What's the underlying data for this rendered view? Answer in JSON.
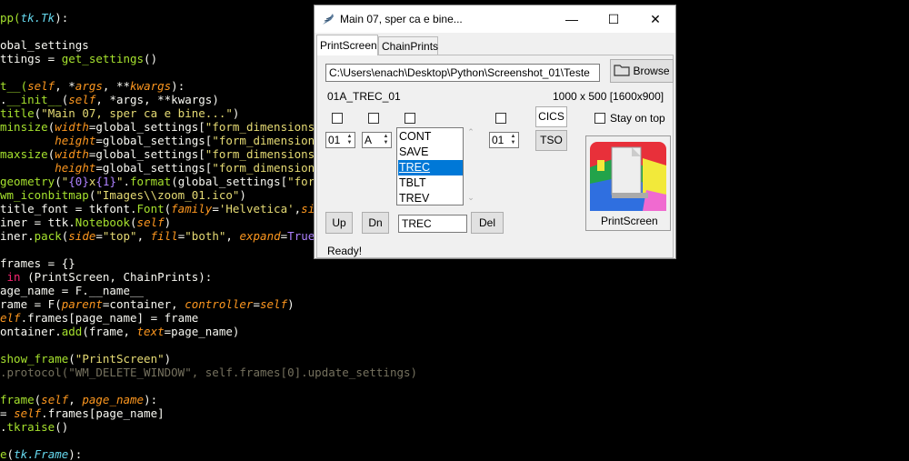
{
  "editor": {
    "lines": [
      {
        "segs": [
          [
            "c-g",
            "pp("
          ],
          [
            "c-b",
            "tk.Tk"
          ],
          [
            "c-w",
            "):"
          ]
        ]
      },
      {
        "segs": []
      },
      {
        "segs": [
          [
            "c-w",
            "obal_settings"
          ]
        ]
      },
      {
        "segs": [
          [
            "c-w",
            "ttings = "
          ],
          [
            "c-g",
            "get_settings"
          ],
          [
            "c-w",
            "()"
          ]
        ]
      },
      {
        "segs": []
      },
      {
        "segs": [
          [
            "c-g",
            "t__("
          ],
          [
            "c-o",
            "self"
          ],
          [
            "c-w",
            ", *"
          ],
          [
            "c-o",
            "args"
          ],
          [
            "c-w",
            ", **"
          ],
          [
            "c-o",
            "kwargs"
          ],
          [
            "c-w",
            "):"
          ]
        ]
      },
      {
        "segs": [
          [
            "c-w",
            "."
          ],
          [
            "c-g",
            "__init__"
          ],
          [
            "c-w",
            "("
          ],
          [
            "c-o",
            "self"
          ],
          [
            "c-w",
            ", *args, **kwargs)"
          ]
        ]
      },
      {
        "segs": [
          [
            "c-g",
            "title"
          ],
          [
            "c-w",
            "("
          ],
          [
            "c-s",
            "\"Main 07, sper ca e bine...\""
          ],
          [
            "c-w",
            ")"
          ]
        ]
      },
      {
        "segs": [
          [
            "c-g",
            "minsize"
          ],
          [
            "c-w",
            "("
          ],
          [
            "c-o",
            "width"
          ],
          [
            "c-w",
            "=global_settings["
          ],
          [
            "c-s",
            "\"form_dimensions\""
          ],
          [
            "c-w",
            "]["
          ]
        ]
      },
      {
        "segs": [
          [
            "c-w",
            "        "
          ],
          [
            "c-o",
            "height"
          ],
          [
            "c-w",
            "=global_settings["
          ],
          [
            "c-s",
            "\"form_dimensions\""
          ],
          [
            "c-w",
            "]["
          ]
        ]
      },
      {
        "segs": [
          [
            "c-g",
            "maxsize"
          ],
          [
            "c-w",
            "("
          ],
          [
            "c-o",
            "width"
          ],
          [
            "c-w",
            "=global_settings["
          ],
          [
            "c-s",
            "\"form_dimensions\""
          ],
          [
            "c-w",
            "]["
          ]
        ]
      },
      {
        "segs": [
          [
            "c-w",
            "        "
          ],
          [
            "c-o",
            "height"
          ],
          [
            "c-w",
            "=global_settings["
          ],
          [
            "c-s",
            "\"form_dimensions\""
          ],
          [
            "c-w",
            "]["
          ]
        ]
      },
      {
        "segs": [
          [
            "c-g",
            "geometry"
          ],
          [
            "c-w",
            "("
          ],
          [
            "c-s",
            "\""
          ],
          [
            "c-p",
            "{0}"
          ],
          [
            "c-s",
            "x"
          ],
          [
            "c-p",
            "{1}"
          ],
          [
            "c-s",
            "\""
          ],
          [
            "c-w",
            "."
          ],
          [
            "c-g",
            "format"
          ],
          [
            "c-w",
            "(global_settings["
          ],
          [
            "c-s",
            "\"form_d"
          ]
        ]
      },
      {
        "segs": [
          [
            "c-g",
            "wm_iconbitmap"
          ],
          [
            "c-w",
            "("
          ],
          [
            "c-s",
            "\"Images\\\\zoom_01.ico\""
          ],
          [
            "c-w",
            ")"
          ]
        ]
      },
      {
        "segs": [
          [
            "c-w",
            "title_font = tkfont."
          ],
          [
            "c-g",
            "Font"
          ],
          [
            "c-w",
            "("
          ],
          [
            "c-o",
            "family"
          ],
          [
            "c-w",
            "="
          ],
          [
            "c-s",
            "'Helvetica'"
          ],
          [
            "c-w",
            ","
          ],
          [
            "c-o",
            "size"
          ],
          [
            "c-w",
            "="
          ]
        ]
      },
      {
        "segs": [
          [
            "c-w",
            "iner = ttk."
          ],
          [
            "c-g",
            "Notebook"
          ],
          [
            "c-w",
            "("
          ],
          [
            "c-o",
            "self"
          ],
          [
            "c-w",
            ")"
          ]
        ]
      },
      {
        "segs": [
          [
            "c-w",
            "iner."
          ],
          [
            "c-g",
            "pack"
          ],
          [
            "c-w",
            "("
          ],
          [
            "c-o",
            "side"
          ],
          [
            "c-w",
            "="
          ],
          [
            "c-s",
            "\"top\""
          ],
          [
            "c-w",
            ", "
          ],
          [
            "c-o",
            "fill"
          ],
          [
            "c-w",
            "="
          ],
          [
            "c-s",
            "\"both\""
          ],
          [
            "c-w",
            ", "
          ],
          [
            "c-o",
            "expand"
          ],
          [
            "c-w",
            "="
          ],
          [
            "c-p",
            "True"
          ],
          [
            "c-w",
            ")"
          ]
        ]
      },
      {
        "segs": []
      },
      {
        "segs": [
          [
            "c-w",
            "frames = {}"
          ]
        ]
      },
      {
        "segs": [
          [
            "c-k",
            " in "
          ],
          [
            "c-w",
            "(PrintScreen, ChainPrints):"
          ]
        ]
      },
      {
        "segs": [
          [
            "c-w",
            "age_name = F.__name__"
          ]
        ]
      },
      {
        "segs": [
          [
            "c-w",
            "rame = F("
          ],
          [
            "c-o",
            "parent"
          ],
          [
            "c-w",
            "=container, "
          ],
          [
            "c-o",
            "controller"
          ],
          [
            "c-w",
            "="
          ],
          [
            "c-o",
            "self"
          ],
          [
            "c-w",
            ")"
          ]
        ]
      },
      {
        "segs": [
          [
            "c-o",
            "elf"
          ],
          [
            "c-w",
            ".frames[page_name] = frame"
          ]
        ]
      },
      {
        "segs": [
          [
            "c-w",
            "ontainer."
          ],
          [
            "c-g",
            "add"
          ],
          [
            "c-w",
            "(frame, "
          ],
          [
            "c-o",
            "text"
          ],
          [
            "c-w",
            "=page_name)"
          ]
        ]
      },
      {
        "segs": []
      },
      {
        "segs": [
          [
            "c-g",
            "show_frame"
          ],
          [
            "c-w",
            "("
          ],
          [
            "c-s",
            "\"PrintScreen\""
          ],
          [
            "c-w",
            ")"
          ]
        ]
      },
      {
        "segs": [
          [
            "c-dim",
            ".protocol(\"WM_DELETE_WINDOW\", self.frames[0].update_settings)"
          ]
        ]
      },
      {
        "segs": []
      },
      {
        "segs": [
          [
            "c-g",
            "frame"
          ],
          [
            "c-w",
            "("
          ],
          [
            "c-o",
            "self"
          ],
          [
            "c-w",
            ", "
          ],
          [
            "c-o",
            "page_name"
          ],
          [
            "c-w",
            "):"
          ]
        ]
      },
      {
        "segs": [
          [
            "c-w",
            "= "
          ],
          [
            "c-o",
            "self"
          ],
          [
            "c-w",
            ".frames[page_name]"
          ]
        ]
      },
      {
        "segs": [
          [
            "c-w",
            "."
          ],
          [
            "c-g",
            "tkraise"
          ],
          [
            "c-w",
            "()"
          ]
        ]
      },
      {
        "segs": []
      },
      {
        "segs": [
          [
            "c-g",
            "e"
          ],
          [
            "c-w",
            "("
          ],
          [
            "c-b",
            "tk.Frame"
          ],
          [
            "c-w",
            "):"
          ]
        ]
      }
    ]
  },
  "window": {
    "title": "Main 07, sper ca e bine...",
    "minimize": "—",
    "maximize": "☐",
    "close": "✕"
  },
  "tabs": [
    "PrintScreen",
    "ChainPrints"
  ],
  "printscreen": {
    "path_value": "C:\\Users\\enach\\Desktop\\Python\\Screenshot_01\\Teste",
    "browse_label": "Browse",
    "screen_name": "01A_TREC_01",
    "resolution": "1000 x 500 [1600x900]",
    "spin1_value": "01",
    "spin2_value": "A",
    "spin3_value": "01",
    "list_items": [
      "CONT",
      "SAVE",
      "TREC",
      "TBLT",
      "TREV"
    ],
    "list_selected": "TREC",
    "cics_label": "CICS",
    "tso_label": "TSO",
    "stay_on_top_label": "Stay on top",
    "up_label": "Up",
    "dn_label": "Dn",
    "entry_value": "TREC",
    "del_label": "Del",
    "thumbnail_label": "PrintScreen",
    "status": "Ready!"
  }
}
